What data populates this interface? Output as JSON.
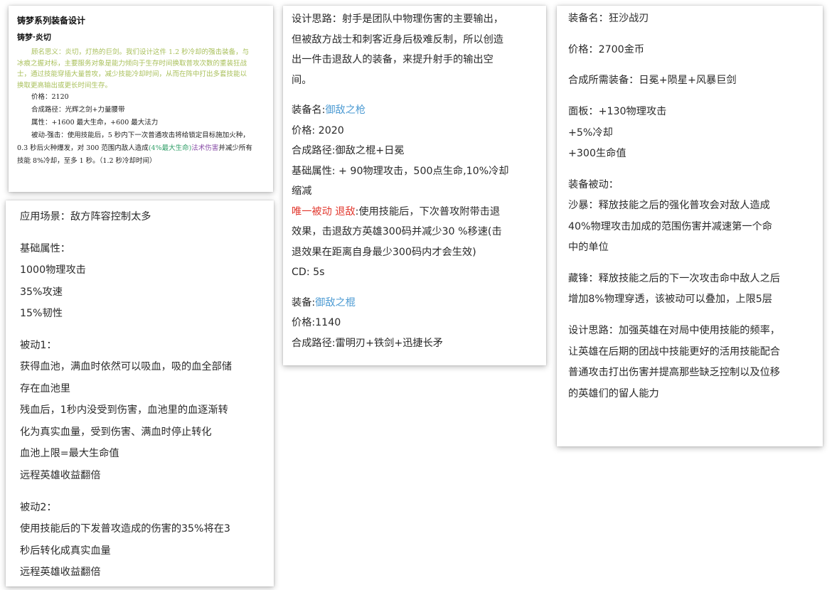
{
  "card1": {
    "title": "铸梦系列装备设计",
    "subtitle": "铸梦·炎切",
    "intro": [
      "顾名思义：炎切，灯热的巨剑。我们设计这件 1.2 秒冷却的强击装备，与",
      "冰痕之握对标，主要服务对象是能力倾向于生存时间换取普攻次数的重装狂战",
      "士，通过技能穿插大量普攻，减少技能冷却时间，从而在阵中打出多套技能以",
      "换取更高输出或更长时间生存。"
    ],
    "price": "价格：2120",
    "recipe": "合成路径：光辉之剑+力量腰带",
    "stats": "属性：+1600 最大生命，+600 最大法力",
    "passive_a": "被动-强击：使用技能后，5 秒内下一次普通攻击将给锁定目标施加火种，",
    "passive_b": "0.3 秒后火种爆发，对 300 范围内敌人造成",
    "passive_b_green": "(4%最大生命)",
    "passive_b_purple": "法术伤害",
    "passive_b_end": "并减少所有",
    "passive_c": "技能 8%冷却，至多 1 秒。（1.2 秒冷却时间）"
  },
  "card2": {
    "lines": [
      "应用场景：敌方阵容控制太多",
      "",
      "基础属性：",
      "1000物理攻击",
      "35%攻速",
      "15%韧性",
      "",
      "被动1：",
      "获得血池，满血时依然可以吸血，吸的血全部储",
      "存在血池里",
      "残血后，1秒内没受到伤害，血池里的血逐渐转",
      "化为真实血量，受到伤害、满血时停止转化",
      "血池上限=最大生命值",
      "远程英雄收益翻倍",
      "",
      "被动2：",
      "使用技能后的下发普攻造成的伤害的35%将在3",
      "秒后转化成真实血量",
      "远程英雄收益翻倍"
    ]
  },
  "card3": {
    "design": [
      "设计思路：射手是团队中物理伤害的主要输出，",
      "但被敌方战士和刺客近身后极难反制，所以创造",
      "出一件击退敌人的装备，来提升射手的输出空",
      "间。"
    ],
    "item1_prefix": "装备名:",
    "item1_name": "御敌之枪",
    "item1_price": "价格: 2020",
    "item1_recipe": "合成路径:御敌之棍+日冕",
    "item1_stats_a": "基础属性: + 90物理攻击，500点生命,10%冷却",
    "item1_stats_b": "缩减",
    "item1_passive_label": "唯一被动 退敌",
    "item1_passive_a": ":使用技能后，下次普攻附带击退",
    "item1_passive_b": "效果，击退敌方英雄300码并减少30 %移速(击",
    "item1_passive_c": "退效果在距离自身最少300码内才会生效)",
    "item1_cd": "CD: 5s",
    "item2_prefix": "装备:",
    "item2_name": "御敌之棍",
    "item2_price": "价格:1140",
    "item2_recipe": "合成路径:雷明刃+铁剑+迅捷长矛"
  },
  "card4": {
    "lines": [
      "装备名：狂沙战刃",
      "",
      "价格：2700金币",
      "",
      "合成所需装备：日冕+陨星+风暴巨剑",
      "",
      "面板：+130物理攻击",
      "+5%冷却",
      "+300生命值",
      "",
      "装备被动：",
      "沙暴：释放技能之后的强化普攻会对敌人造成",
      "40%物理攻击加成的范围伤害并减速第一个命",
      "中的单位",
      "",
      "藏锋：释放技能之后的下一次攻击命中敌人之后",
      "增加8%物理穿透，该被动可以叠加，上限5层",
      "",
      "设计思路：加强英雄在对局中使用技能的频率，",
      "让英雄在后期的团战中技能更好的活用技能配合",
      "普通攻击打出伤害并提高那些缺乏控制以及位移",
      "的英雄们的留人能力"
    ]
  }
}
